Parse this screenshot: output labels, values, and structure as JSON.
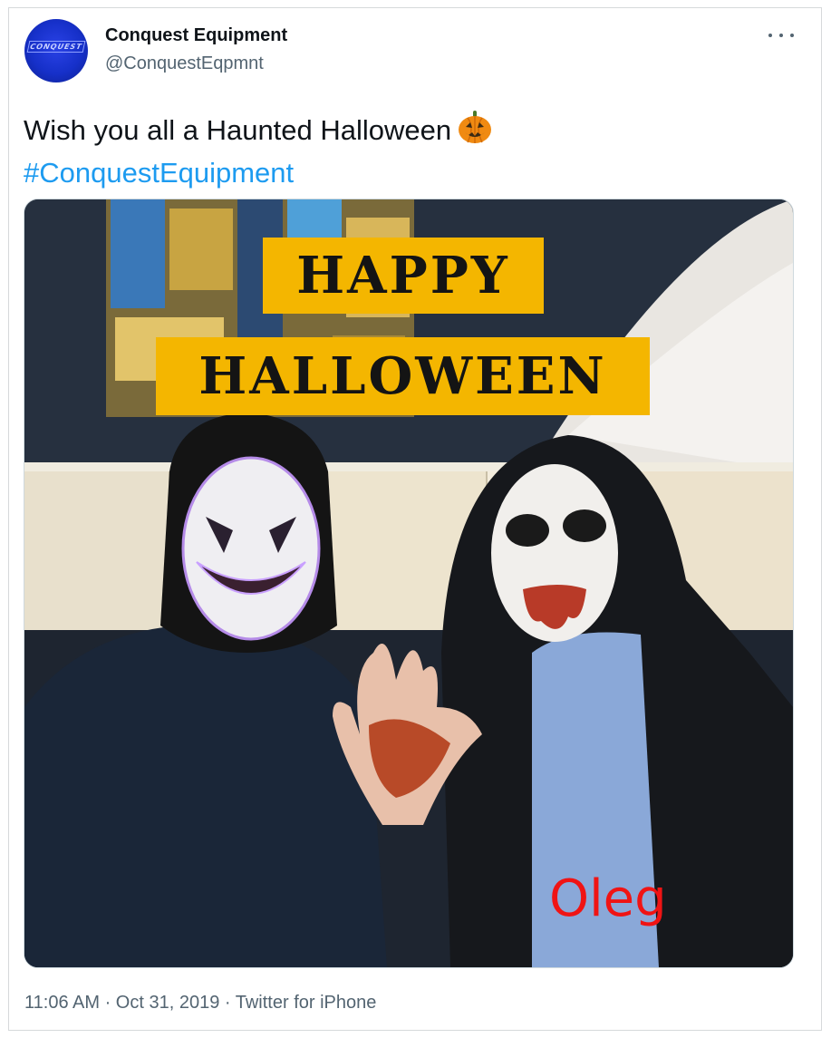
{
  "tweet": {
    "author_name": "Conquest Equipment",
    "author_handle": "@ConquestEqpmnt",
    "avatar_text": "CONQUEST",
    "text": "Wish you all a Haunted Halloween",
    "hashtag": "#ConquestEquipment",
    "emoji_icon": "jack-o-lantern-icon",
    "timestamp": "11:06 AM · Oct 31, 2019 · ",
    "source": "Twitter for iPhone"
  },
  "media": {
    "banner_line1": "HAPPY",
    "banner_line2": "HALLOWEEN",
    "caption": "Oleg"
  },
  "colors": {
    "link": "#1d9bf0",
    "text": "#0f1419",
    "secondary": "#536471",
    "banner": "#f4b600",
    "caption": "#f01414"
  }
}
